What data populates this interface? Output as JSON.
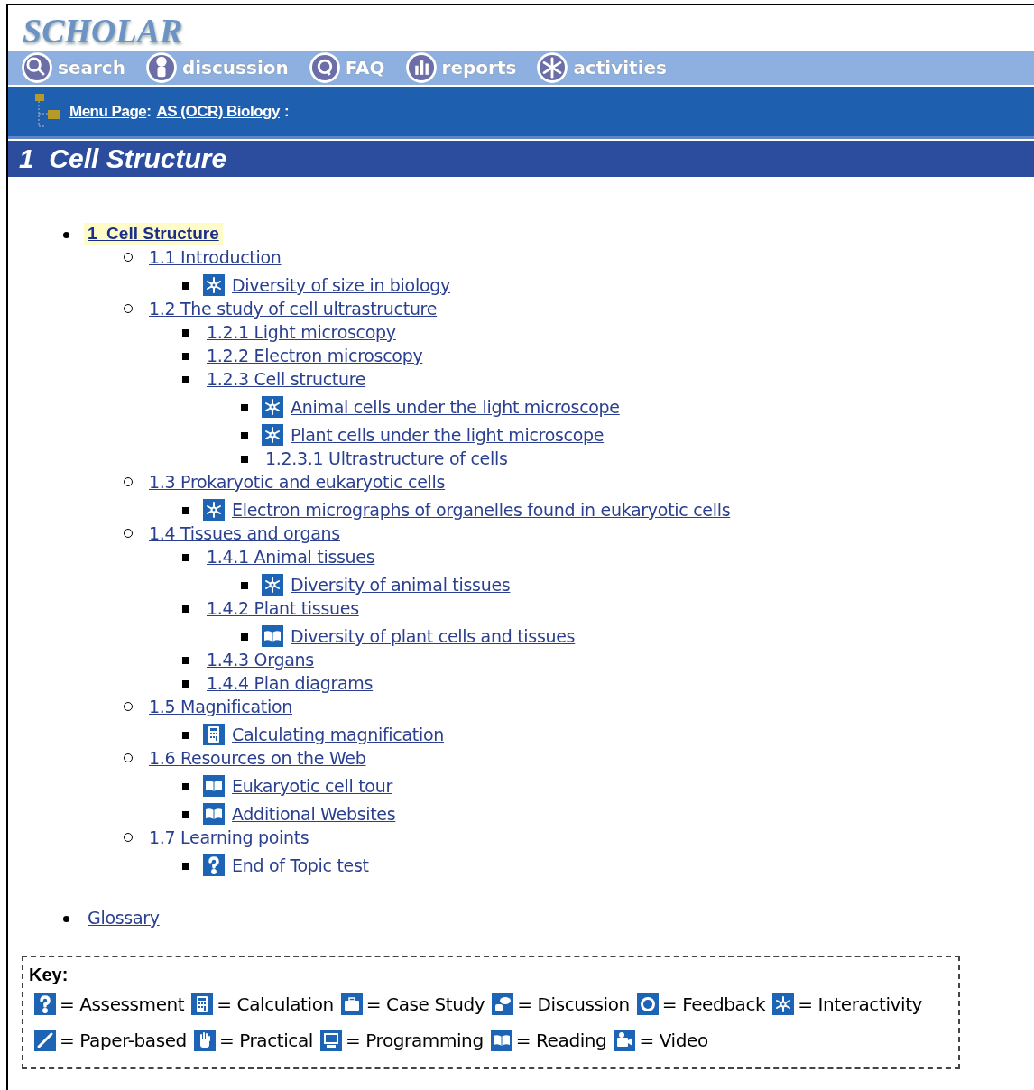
{
  "logo": "SCHOLAR",
  "nav": [
    {
      "label": "search",
      "kind": "search"
    },
    {
      "label": "discussion",
      "kind": "discussion"
    },
    {
      "label": "FAQ",
      "kind": "faq"
    },
    {
      "label": "reports",
      "kind": "reports"
    },
    {
      "label": "activities",
      "kind": "activities"
    }
  ],
  "breadcrumb": {
    "links": [
      "Menu Page",
      "AS (OCR) Biology"
    ],
    "separator": ":"
  },
  "title": "1  Cell Structure",
  "tree": [
    {
      "label": "1  Cell Structure",
      "selected": true,
      "children": [
        {
          "label": "1.1 Introduction",
          "selected": false,
          "children": [
            {
              "label": "Diversity of size in biology",
              "kind": "interactivity",
              "selected": false
            }
          ]
        },
        {
          "label": "1.2 The study of cell ultrastructure",
          "selected": false,
          "children": [
            {
              "label": "1.2.1 Light microscopy",
              "selected": false
            },
            {
              "label": "1.2.2 Electron microscopy",
              "selected": false
            },
            {
              "label": "1.2.3 Cell structure",
              "selected": false,
              "children": [
                {
                  "label": "Animal cells under the light microscope",
                  "kind": "interactivity",
                  "selected": false
                },
                {
                  "label": "Plant cells under the light microscope",
                  "kind": "interactivity",
                  "selected": false
                },
                {
                  "label": "1.2.3.1 Ultrastructure of cells",
                  "selected": false
                }
              ]
            }
          ]
        },
        {
          "label": "1.3 Prokaryotic and eukaryotic cells",
          "selected": false,
          "children": [
            {
              "label": "Electron micrographs of organelles found in eukaryotic cells",
              "kind": "interactivity",
              "selected": false
            }
          ]
        },
        {
          "label": "1.4 Tissues and organs",
          "selected": false,
          "children": [
            {
              "label": "1.4.1 Animal tissues",
              "selected": false,
              "children": [
                {
                  "label": "Diversity of animal tissues",
                  "kind": "interactivity",
                  "selected": false
                }
              ]
            },
            {
              "label": "1.4.2 Plant tissues",
              "selected": false,
              "children": [
                {
                  "label": "Diversity of plant cells and tissues",
                  "kind": "reading",
                  "selected": false
                }
              ]
            },
            {
              "label": "1.4.3 Organs",
              "selected": false
            },
            {
              "label": "1.4.4 Plan diagrams",
              "selected": false
            }
          ]
        },
        {
          "label": "1.5 Magnification",
          "selected": false,
          "children": [
            {
              "label": "Calculating magnification",
              "kind": "calculation",
              "selected": false
            }
          ]
        },
        {
          "label": "1.6 Resources on the Web",
          "selected": false,
          "children": [
            {
              "label": "Eukaryotic cell tour",
              "kind": "reading",
              "selected": false
            },
            {
              "label": "Additional Websites",
              "kind": "reading",
              "selected": false
            }
          ]
        },
        {
          "label": "1.7 Learning points",
          "selected": false,
          "children": [
            {
              "label": "End of Topic test",
              "kind": "assessment",
              "selected": false
            }
          ]
        }
      ]
    },
    {
      "label": "Glossary",
      "selected": false
    }
  ],
  "key": {
    "title": "Key:",
    "rows": [
      [
        {
          "kind": "assessment",
          "label": "= Assessment"
        },
        {
          "kind": "calculation",
          "label": "= Calculation"
        },
        {
          "kind": "case-study",
          "label": "= Case Study"
        },
        {
          "kind": "discussion",
          "label": "= Discussion"
        },
        {
          "kind": "feedback",
          "label": "= Feedback"
        },
        {
          "kind": "interactivity",
          "label": "= Interactivity"
        }
      ],
      [
        {
          "kind": "paper",
          "label": "= Paper-based"
        },
        {
          "kind": "practical",
          "label": "= Practical"
        },
        {
          "kind": "programming",
          "label": "= Programming"
        },
        {
          "kind": "reading",
          "label": "= Reading"
        },
        {
          "kind": "video",
          "label": "= Video"
        }
      ]
    ]
  }
}
